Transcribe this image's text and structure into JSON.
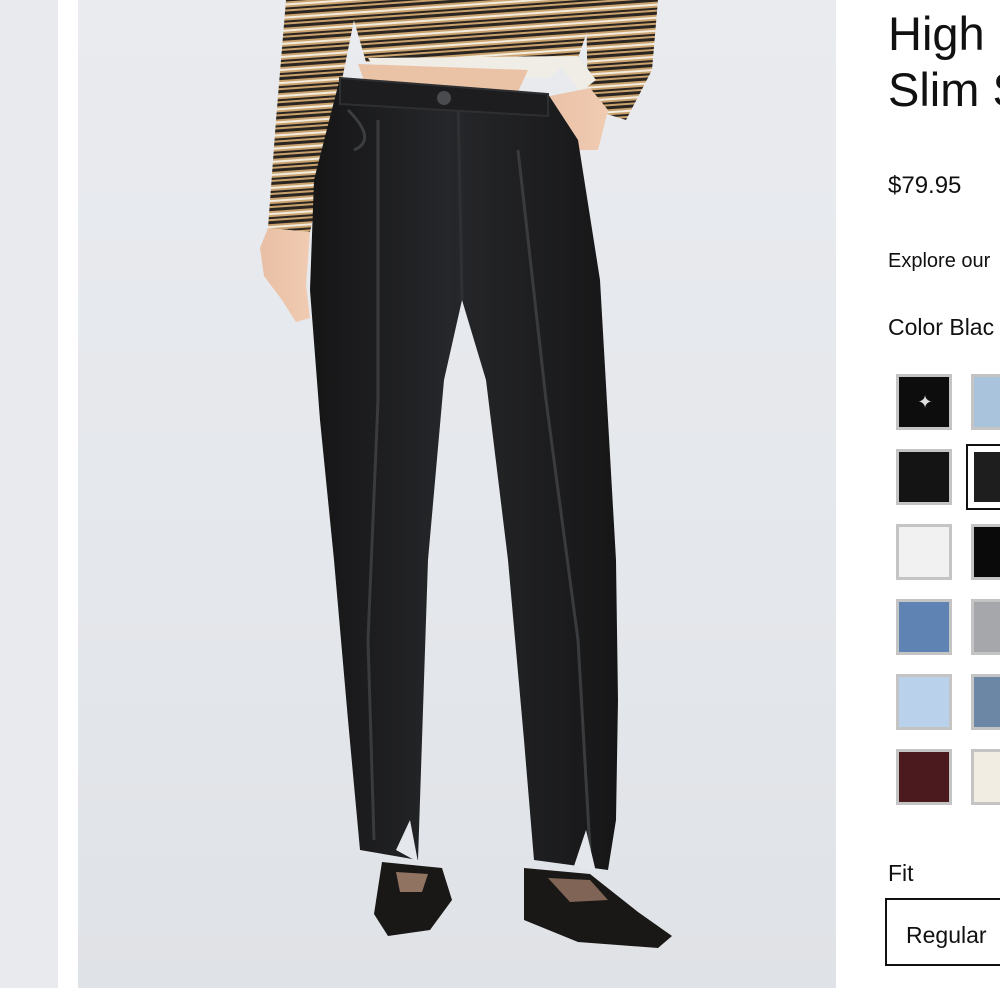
{
  "product": {
    "title_line1": "High",
    "title_line2": "Slim S",
    "price": "$79.95",
    "explore_text": "Explore our",
    "color_label": "Color",
    "color_value": "Blac"
  },
  "swatches": [
    {
      "name": "black-embellished",
      "color": "#0d0d0d",
      "selected": false
    },
    {
      "name": "light-blue-wash",
      "color": "#a9c3dd",
      "selected": false
    },
    {
      "name": "black",
      "color": "#141414",
      "selected": false
    },
    {
      "name": "washed-black",
      "color": "#1e1e1e",
      "selected": true
    },
    {
      "name": "white",
      "color": "#f1f1f1",
      "selected": false
    },
    {
      "name": "black-rinse",
      "color": "#0a0a0a",
      "selected": false
    },
    {
      "name": "medium-blue-wash",
      "color": "#5f84b3",
      "selected": false
    },
    {
      "name": "grey-wash",
      "color": "#a5a7aa",
      "selected": false
    },
    {
      "name": "light-blue",
      "color": "#b9d1ea",
      "selected": false
    },
    {
      "name": "steel-blue-wash",
      "color": "#6c87a6",
      "selected": false
    },
    {
      "name": "burgundy",
      "color": "#4a1a1e",
      "selected": false
    },
    {
      "name": "ecru",
      "color": "#f2ede2",
      "selected": false
    }
  ],
  "fit": {
    "label": "Fit",
    "selected_option": "Regular"
  },
  "colors": {
    "text": "#111111",
    "gallery_bg": "#e6e9ed",
    "denim": "#1f1f20"
  }
}
